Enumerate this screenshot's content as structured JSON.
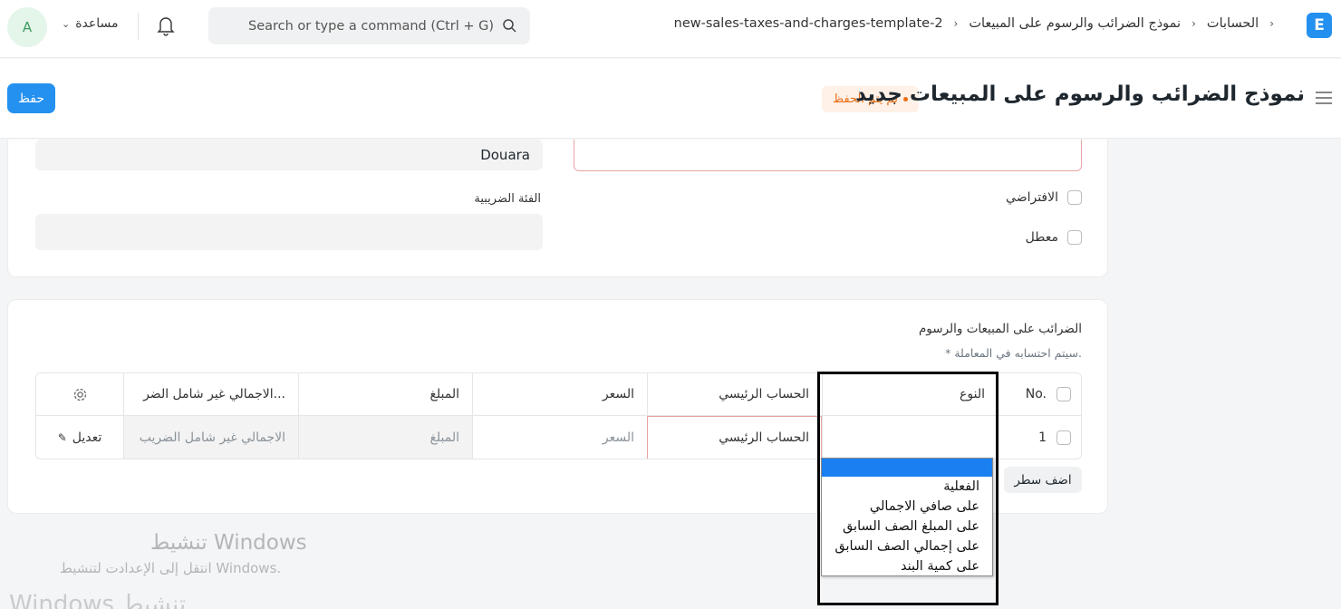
{
  "navbar": {
    "avatar_letter": "A",
    "help_label": "مساعدة",
    "search_placeholder": "Search or type a command (Ctrl + G)",
    "breadcrumb": [
      "الحسابات",
      "نموذج الضرائب والرسوم على المبيعات",
      "new-sales-taxes-and-charges-template-2"
    ],
    "logo_letter": "E"
  },
  "header": {
    "title": "نموذج الضرائب والرسوم على المبيعات جديد",
    "status_badge": "لم يتم الحفظ",
    "save_label": "حفظ",
    "accent_color": "#2490ef"
  },
  "form": {
    "company_value": "Douara",
    "tax_category_label": "الفئة الضريبية",
    "default_label": "الافتراضي",
    "disabled_label": "معطل"
  },
  "taxes_section": {
    "title": "الضرائب على المبيعات والرسوم",
    "note": "* سيتم احتسابه في المعاملة.",
    "columns": {
      "no": "No.",
      "type": "النوع",
      "account_head": "الحساب الرئيسي",
      "rate": "السعر",
      "amount": "المبلغ",
      "total": "الاجمالي غير شامل الضر..."
    },
    "row": {
      "idx": "1",
      "type": "",
      "account_head": "الحساب الرئيسي",
      "rate": "السعر",
      "amount": "المبلغ",
      "total": "الاجمالي غير شامل الضريب",
      "edit_label": "تعديل"
    },
    "add_row_label": "اضف سطر"
  },
  "type_dropdown": {
    "options": [
      "",
      "الفعلية",
      "على صافي الاجمالي",
      "على المبلغ الصف السابق",
      "على إجمالي الصف السابق",
      "على كمية البند"
    ],
    "selected_index": 0
  },
  "watermark": {
    "title": "تنشيط Windows",
    "subtitle": "انتقل إلى الإعدادت لتنشيط Windows.",
    "bottom": "Windows تنشيط"
  }
}
